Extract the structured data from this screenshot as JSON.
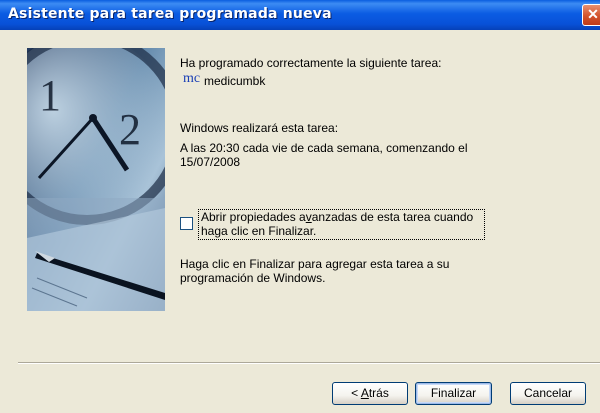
{
  "window": {
    "title": "Asistente para tarea programada nueva",
    "close_glyph": "✕"
  },
  "content": {
    "success_text": "Ha programado correctamente la siguiente tarea:",
    "task_icon": "mc",
    "task_name": "medicumbk",
    "perform_text": "Windows realizará esta tarea:",
    "schedule_line1": "A las 20:30 cada vie de cada semana, comenzando el",
    "schedule_line2": "15/07/2008",
    "checkbox_label_line1_pre": "Abrir propiedades a",
    "checkbox_label_line1_key": "v",
    "checkbox_label_line1_post": "anzadas de esta tarea cuando",
    "checkbox_label_line2": "haga clic en Finalizar.",
    "checkbox_checked": false,
    "finish_text_line1": "Haga clic en Finalizar para agregar esta tarea a su",
    "finish_text_line2": "programación de Windows."
  },
  "buttons": {
    "back_prefix": "< ",
    "back_key": "A",
    "back_rest": "trás",
    "finish": "Finalizar",
    "cancel": "Cancelar"
  },
  "icons": {
    "wizard_art": "clock-and-fountain-pen-image",
    "task": "task-icon"
  }
}
